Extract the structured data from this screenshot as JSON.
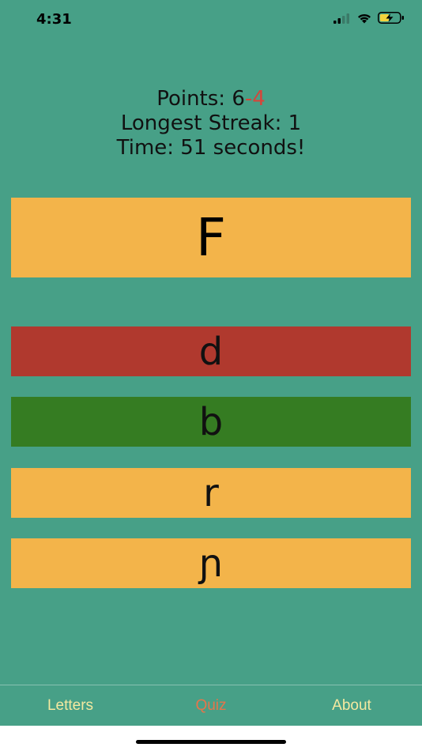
{
  "status_bar": {
    "time": "4:31",
    "icons": [
      "cellular-signal-icon",
      "wifi-icon",
      "battery-charging-icon"
    ]
  },
  "stats": {
    "points_label": "Points: ",
    "points_correct": "6",
    "points_wrong": "-4",
    "longest_streak": "Longest Streak: 1",
    "time": "Time: 51 seconds!"
  },
  "quiz": {
    "prompt": "F",
    "answers": [
      {
        "label": "d",
        "state": "wrong",
        "color": "#B0392E"
      },
      {
        "label": "b",
        "state": "correct",
        "color": "#357C22"
      },
      {
        "label": "r",
        "state": "neutral",
        "color": "#F3B44A"
      },
      {
        "label": "ɲ",
        "state": "neutral",
        "color": "#F3B44A"
      }
    ]
  },
  "tab_bar": {
    "tabs": [
      {
        "label": "Letters",
        "active": false
      },
      {
        "label": "Quiz",
        "active": true
      },
      {
        "label": "About",
        "active": false
      }
    ]
  },
  "colors": {
    "background": "#47A087",
    "card": "#F3B44A",
    "wrong": "#B0392E",
    "correct": "#357C22",
    "tab_text": "#F4E9A0",
    "tab_active": "#E7744A",
    "negative_points": "#D6453A"
  }
}
